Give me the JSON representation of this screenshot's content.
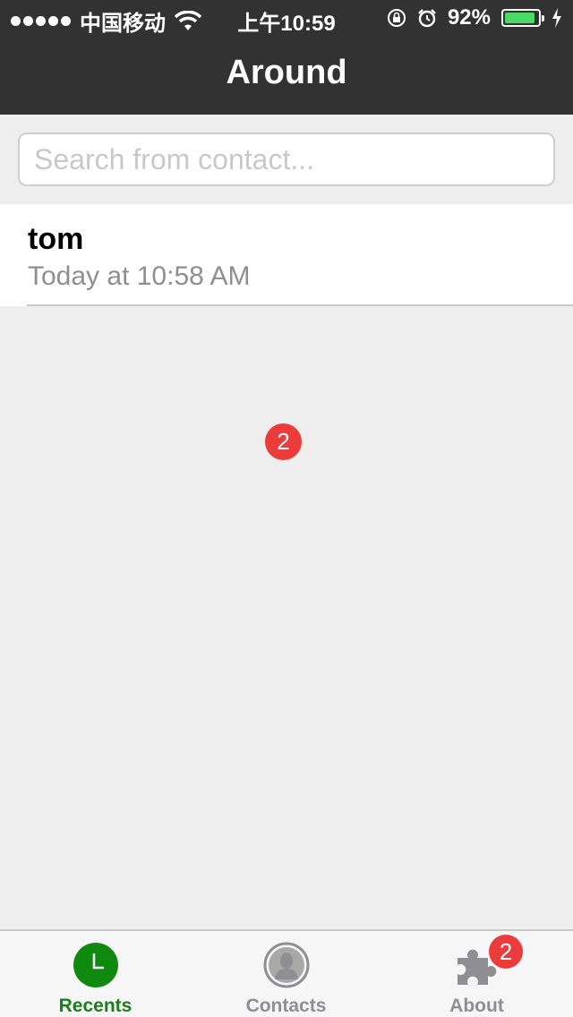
{
  "status_bar": {
    "carrier": "中国移动",
    "time": "上午10:59",
    "battery": "92%",
    "battery_level": 0.92
  },
  "nav": {
    "title": "Around"
  },
  "search": {
    "placeholder": "Search from contact..."
  },
  "recents": [
    {
      "name": "tom",
      "time": "Today at 10:58 AM",
      "badge": "2"
    }
  ],
  "tabs": [
    {
      "label": "Recents",
      "icon": "clock-icon",
      "active": true
    },
    {
      "label": "Contacts",
      "icon": "person-icon",
      "active": false
    },
    {
      "label": "About",
      "icon": "puzzle-icon",
      "active": false,
      "badge": "2"
    }
  ],
  "colors": {
    "nav_background": "#323232",
    "accent_green": "#1a7f1a",
    "badge_red": "#ec3b3b",
    "battery_green": "#4cd964"
  }
}
